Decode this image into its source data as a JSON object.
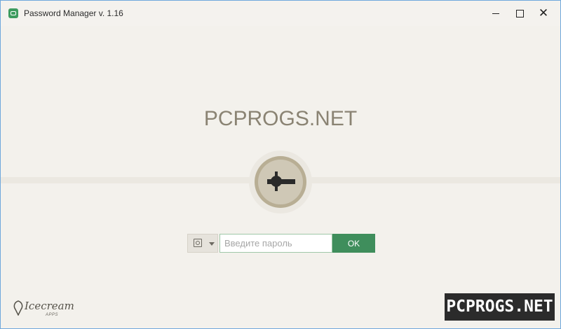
{
  "window": {
    "title": "Password Manager v. 1.16",
    "icon": "password-manager-app-icon",
    "controls": {
      "minimize": "minimize-icon",
      "maximize": "maximize-icon",
      "close": "close-icon"
    }
  },
  "main": {
    "brand_text": "PCPROGS.NET",
    "lock_icon": "lock-key-icon"
  },
  "form": {
    "type_selector_icon": "safe-icon",
    "password_placeholder": "Введите пароль",
    "password_value": "",
    "ok_label": "OK"
  },
  "footer": {
    "logo_text": "Icecream",
    "logo_sub": "APPS"
  },
  "watermark": {
    "text": "PCPROGS.NET"
  },
  "colors": {
    "accent_green": "#3f8e5c",
    "background": "#f3f1ec",
    "lock_ring": "#b8ae94",
    "lock_core": "#cfc8b6",
    "brand_text": "#8a8373"
  }
}
